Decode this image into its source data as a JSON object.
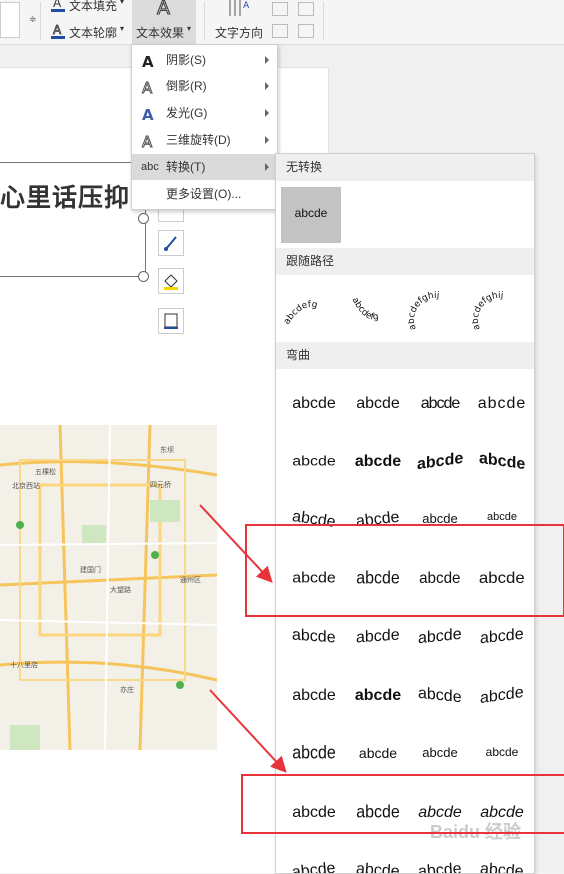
{
  "ribbon": {
    "text_fill": "文本填充",
    "text_outline": "文本轮廓",
    "text_effect": "文本效果",
    "text_direction": "文字方向"
  },
  "canvas": {
    "headline": "心里话压抑"
  },
  "menu": {
    "items": [
      {
        "label": "阴影(S)",
        "icon": "shadow-a-icon",
        "submenu": true
      },
      {
        "label": "倒影(R)",
        "icon": "reflection-a-icon",
        "submenu": true
      },
      {
        "label": "发光(G)",
        "icon": "glow-a-icon",
        "submenu": true
      },
      {
        "label": "三维旋转(D)",
        "icon": "3d-rotation-a-icon",
        "submenu": true
      },
      {
        "label": "转换(T)",
        "icon": "abc-icon",
        "submenu": true,
        "highlighted": true
      },
      {
        "label": "更多设置(O)...",
        "icon": "",
        "submenu": false
      }
    ]
  },
  "panel": {
    "sections": {
      "none": "无转换",
      "follow_path": "跟随路径",
      "warp": "弯曲"
    },
    "none_sample": "abcde",
    "follow_path_samples": [
      "abcdefg",
      "abcdefg",
      "abcdefghij",
      "abcdefghij"
    ],
    "warp_rows": [
      [
        "abcde",
        "abcde",
        "abcde",
        "abcde"
      ],
      [
        "abcde",
        "abcde",
        "abcde",
        "abcde"
      ],
      [
        "abcde",
        "abcde",
        "abcde",
        "abcde"
      ],
      [
        "abcde",
        "abcde",
        "abcde",
        "abcde"
      ],
      [
        "abcde",
        "abcde",
        "abcde",
        "abcde"
      ],
      [
        "abcde",
        "abcde",
        "abcde",
        "abcde"
      ],
      [
        "abcde",
        "abcde",
        "abcde",
        "abcde"
      ],
      [
        "abcde",
        "abcde",
        "abcde",
        "abcde"
      ],
      [
        "abcde",
        "abcde",
        "abcde",
        "abcde"
      ]
    ]
  },
  "map": {
    "labels": [
      "北京西站",
      "五棵松",
      "建国门",
      "四元桥",
      "通州区",
      "大望路",
      "十八里店",
      "亦庄",
      "东坝"
    ]
  },
  "colors": {
    "accent": "#e8333b",
    "highlight": "#dadada"
  },
  "watermark": "Baidu 经验"
}
